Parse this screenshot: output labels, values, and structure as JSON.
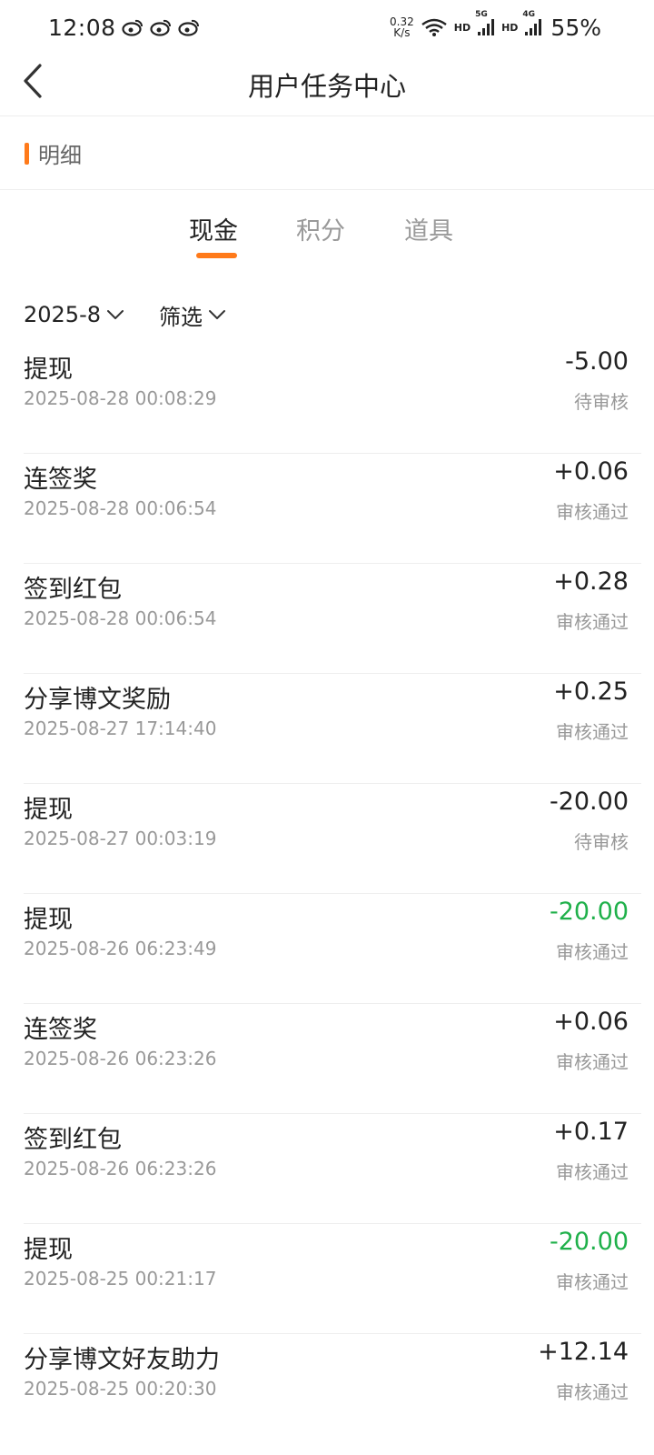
{
  "status_bar": {
    "time": "12:08",
    "net_speed_value": "0.32",
    "net_speed_unit": "K/s",
    "hd1": "HD",
    "sig1_tag": "5G",
    "hd2": "HD",
    "sig2_tag": "4G",
    "battery": "55%"
  },
  "header": {
    "title": "用户任务中心"
  },
  "section": {
    "title": "明细"
  },
  "tabs": [
    {
      "label": "现金",
      "active": true
    },
    {
      "label": "积分",
      "active": false
    },
    {
      "label": "道具",
      "active": false
    }
  ],
  "filters": {
    "month": "2025-8",
    "filter": "筛选"
  },
  "records": [
    {
      "title": "提现",
      "time": "2025-08-28 00:08:29",
      "amount": "-5.00",
      "status": "待审核"
    },
    {
      "title": "连签奖",
      "time": "2025-08-28 00:06:54",
      "amount": "+0.06",
      "status": "审核通过"
    },
    {
      "title": "签到红包",
      "time": "2025-08-28 00:06:54",
      "amount": "+0.28",
      "status": "审核通过"
    },
    {
      "title": "分享博文奖励",
      "time": "2025-08-27 17:14:40",
      "amount": "+0.25",
      "status": "审核通过"
    },
    {
      "title": "提现",
      "time": "2025-08-27 00:03:19",
      "amount": "-20.00",
      "status": "待审核"
    },
    {
      "title": "提现",
      "time": "2025-08-26 06:23:49",
      "amount": "-20.00",
      "status": "审核通过"
    },
    {
      "title": "连签奖",
      "time": "2025-08-26 06:23:26",
      "amount": "+0.06",
      "status": "审核通过"
    },
    {
      "title": "签到红包",
      "time": "2025-08-26 06:23:26",
      "amount": "+0.17",
      "status": "审核通过"
    },
    {
      "title": "提现",
      "time": "2025-08-25 00:21:17",
      "amount": "-20.00",
      "status": "审核通过"
    },
    {
      "title": "分享博文好友助力",
      "time": "2025-08-25 00:20:30",
      "amount": "+12.14",
      "status": "审核通过"
    }
  ],
  "colors": {
    "accent": "#ff7a1a",
    "positive_payout": "#1fb04a",
    "muted_text": "#999999"
  }
}
